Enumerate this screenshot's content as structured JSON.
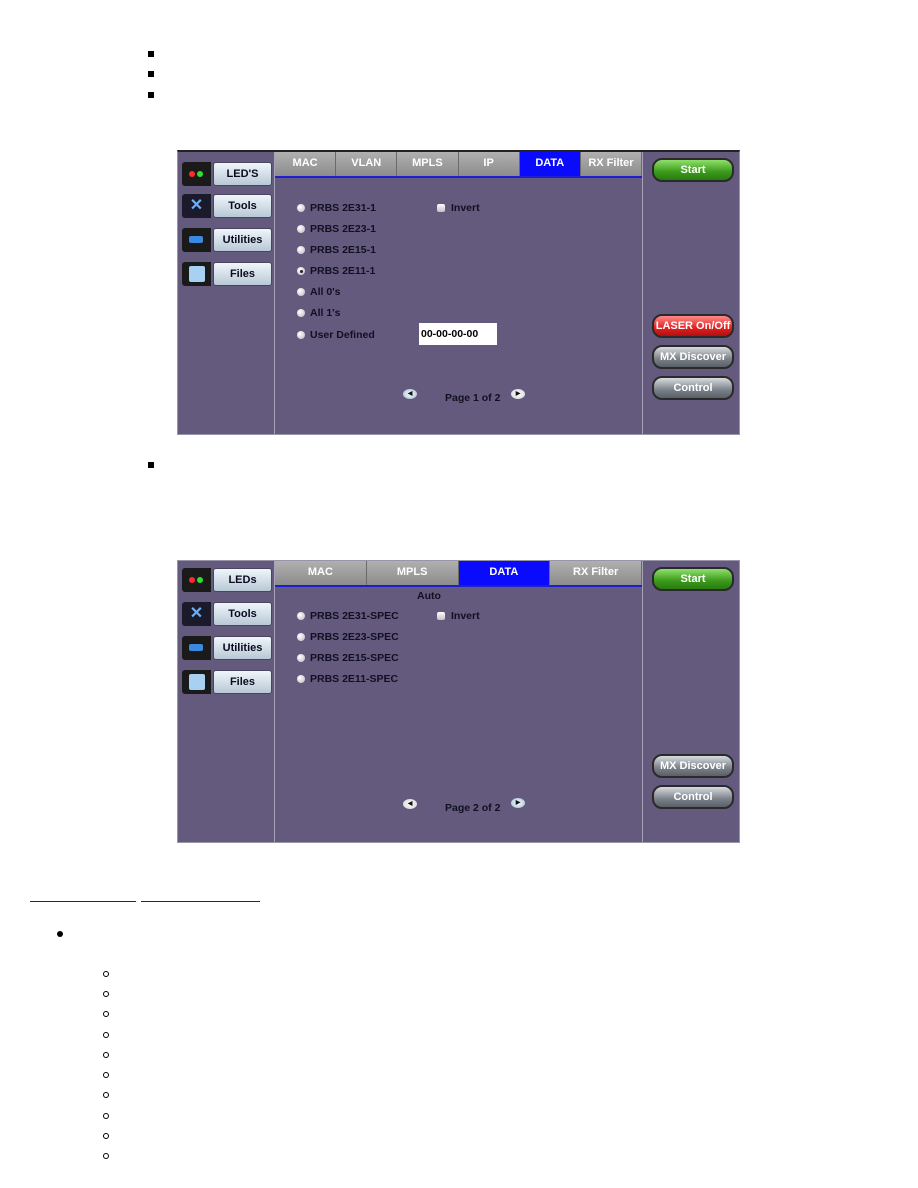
{
  "top_bullets": 3,
  "screen1": {
    "sidebar": [
      {
        "label": "LED'S",
        "icon": "led-icon"
      },
      {
        "label": "Tools",
        "icon": "tools-icon"
      },
      {
        "label": "Utilities",
        "icon": "utilities-icon"
      },
      {
        "label": "Files",
        "icon": "files-icon"
      }
    ],
    "tabs": [
      {
        "label": "MAC",
        "active": false
      },
      {
        "label": "VLAN",
        "active": false
      },
      {
        "label": "MPLS",
        "active": false
      },
      {
        "label": "IP",
        "active": false
      },
      {
        "label": "DATA",
        "active": true
      },
      {
        "label": "RX Filter",
        "active": false
      }
    ],
    "options": [
      {
        "label": "PRBS 2E31-1",
        "selected": false
      },
      {
        "label": "PRBS 2E23-1",
        "selected": false
      },
      {
        "label": "PRBS 2E15-1",
        "selected": false
      },
      {
        "label": "PRBS 2E11-1",
        "selected": true
      },
      {
        "label": "All 0's",
        "selected": false
      },
      {
        "label": "All 1's",
        "selected": false
      },
      {
        "label": "User Defined",
        "selected": false
      }
    ],
    "invert_label": "Invert",
    "invert_checked": false,
    "user_defined_value": "00-00-00-00",
    "page_label": "Page 1 of 2",
    "right_buttons": {
      "start": "Start",
      "laser": "LASER On/Off",
      "mx_discover": "MX Discover",
      "control": "Control"
    }
  },
  "screen2": {
    "sidebar": [
      {
        "label": "LEDs",
        "icon": "led-icon"
      },
      {
        "label": "Tools",
        "icon": "tools-icon"
      },
      {
        "label": "Utilities",
        "icon": "utilities-icon"
      },
      {
        "label": "Files",
        "icon": "files-icon"
      }
    ],
    "tabs": [
      {
        "label": "MAC",
        "active": false
      },
      {
        "label": "MPLS",
        "active": false
      },
      {
        "label": "DATA",
        "active": true
      },
      {
        "label": "RX Filter",
        "active": false
      }
    ],
    "auto_label": "Auto",
    "options": [
      {
        "label": "PRBS 2E31-SPEC",
        "selected": false
      },
      {
        "label": "PRBS 2E23-SPEC",
        "selected": false
      },
      {
        "label": "PRBS 2E15-SPEC",
        "selected": false
      },
      {
        "label": "PRBS 2E11-SPEC",
        "selected": false
      }
    ],
    "invert_label": "Invert",
    "invert_checked": false,
    "page_label": "Page 2 of 2",
    "right_buttons": {
      "start": "Start",
      "mx_discover": "MX Discover",
      "control": "Control"
    }
  },
  "colors": {
    "panel_bg": "#645a7e",
    "active_tab": "#0a0aff",
    "start_green": "#3a9a1a",
    "laser_red": "#e02020"
  }
}
